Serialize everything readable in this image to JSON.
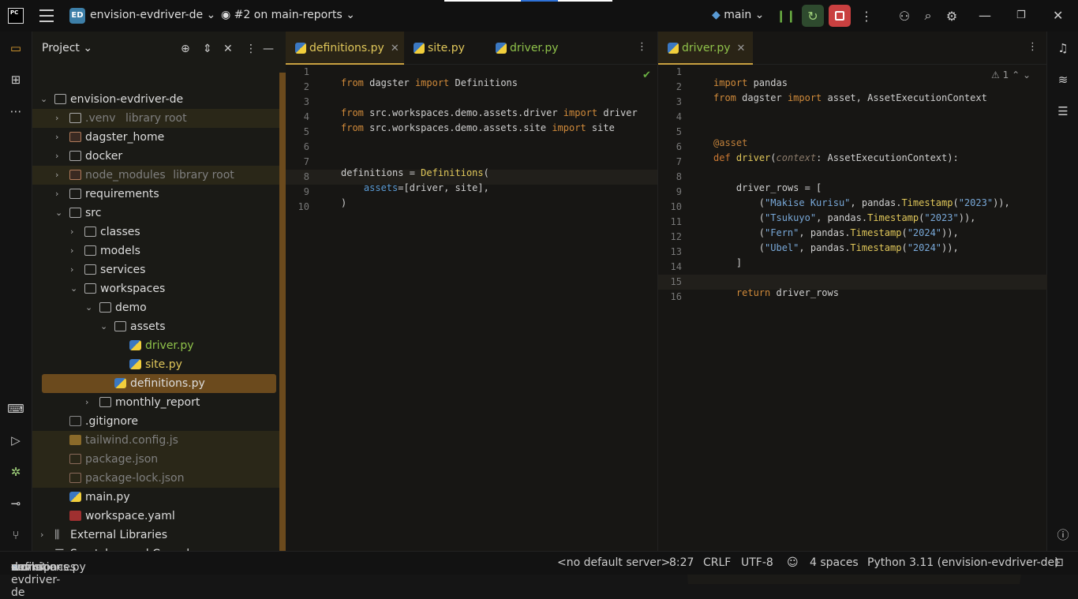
{
  "header": {
    "logo_text": "PC",
    "project_badge": "ED",
    "project_name": "envision-evdriver-de",
    "vcs_label": "#2 on main-reports",
    "branch": "main"
  },
  "project_panel": {
    "title": "Project",
    "tree": [
      {
        "label": "envision-evdriver-de",
        "indent": 0,
        "kind": "folder",
        "expanded": true
      },
      {
        "label": ".venv",
        "suffix": "library root",
        "indent": 1,
        "kind": "folder",
        "style": "dim"
      },
      {
        "label": "dagster_home",
        "indent": 1,
        "kind": "folder-orange"
      },
      {
        "label": "docker",
        "indent": 1,
        "kind": "folder"
      },
      {
        "label": "node_modules",
        "suffix": "library root",
        "indent": 1,
        "kind": "folder-orange",
        "style": "dim"
      },
      {
        "label": "requirements",
        "indent": 1,
        "kind": "folder"
      },
      {
        "label": "src",
        "indent": 1,
        "kind": "folder",
        "expanded": true
      },
      {
        "label": "classes",
        "indent": 2,
        "kind": "folder"
      },
      {
        "label": "models",
        "indent": 2,
        "kind": "folder"
      },
      {
        "label": "services",
        "indent": 2,
        "kind": "folder"
      },
      {
        "label": "workspaces",
        "indent": 2,
        "kind": "folder",
        "expanded": true
      },
      {
        "label": "demo",
        "indent": 3,
        "kind": "folder",
        "expanded": true
      },
      {
        "label": "assets",
        "indent": 4,
        "kind": "folder",
        "expanded": true
      },
      {
        "label": "driver.py",
        "indent": 5,
        "kind": "py",
        "style": "green"
      },
      {
        "label": "site.py",
        "indent": 5,
        "kind": "py",
        "style": "yellow"
      },
      {
        "label": "definitions.py",
        "indent": 4,
        "kind": "py",
        "selected": true
      },
      {
        "label": "monthly_report",
        "indent": 3,
        "kind": "folder"
      },
      {
        "label": ".gitignore",
        "indent": 1,
        "kind": "file"
      },
      {
        "label": "tailwind.config.js",
        "indent": 1,
        "kind": "js",
        "style": "dim"
      },
      {
        "label": "package.json",
        "indent": 1,
        "kind": "json",
        "style": "dim"
      },
      {
        "label": "package-lock.json",
        "indent": 1,
        "kind": "json",
        "style": "dim"
      },
      {
        "label": "main.py",
        "indent": 1,
        "kind": "py"
      },
      {
        "label": "workspace.yaml",
        "indent": 1,
        "kind": "yaml"
      },
      {
        "label": "External Libraries",
        "indent": 0,
        "kind": "lib"
      },
      {
        "label": "Scratches and Consoles",
        "indent": 0,
        "kind": "scratch"
      }
    ]
  },
  "editor_left": {
    "tabs": [
      {
        "label": "definitions.py",
        "active": true,
        "closable": true
      },
      {
        "label": "site.py",
        "style": "yellow"
      },
      {
        "label": "driver.py",
        "style": "green"
      }
    ],
    "lines": [
      "1",
      "2",
      "3",
      "4",
      "5",
      "6",
      "7",
      "8",
      "9",
      "10"
    ]
  },
  "editor_right": {
    "tabs": [
      {
        "label": "driver.py",
        "active": true,
        "closable": true,
        "style": "green"
      }
    ],
    "warning_count": "1",
    "lines": [
      "1",
      "2",
      "3",
      "4",
      "5",
      "6",
      "7",
      "8",
      "9",
      "10",
      "11",
      "12",
      "13",
      "14",
      "15",
      "16"
    ]
  },
  "status": {
    "breadcrumb": [
      "envision-evdriver-de",
      "src",
      "workspaces",
      "demo",
      "definitions.py"
    ],
    "server": "<no default server>",
    "position": "8:27",
    "line_sep": "CRLF",
    "encoding": "UTF-8",
    "indent": "4 spaces",
    "interpreter": "Python 3.11 (envision-evdriver-de)"
  },
  "colors": {
    "accent": "#c8a040",
    "selection": "#6b4a1d",
    "keyword": "#d08a3a",
    "string": "#78a8d8"
  }
}
